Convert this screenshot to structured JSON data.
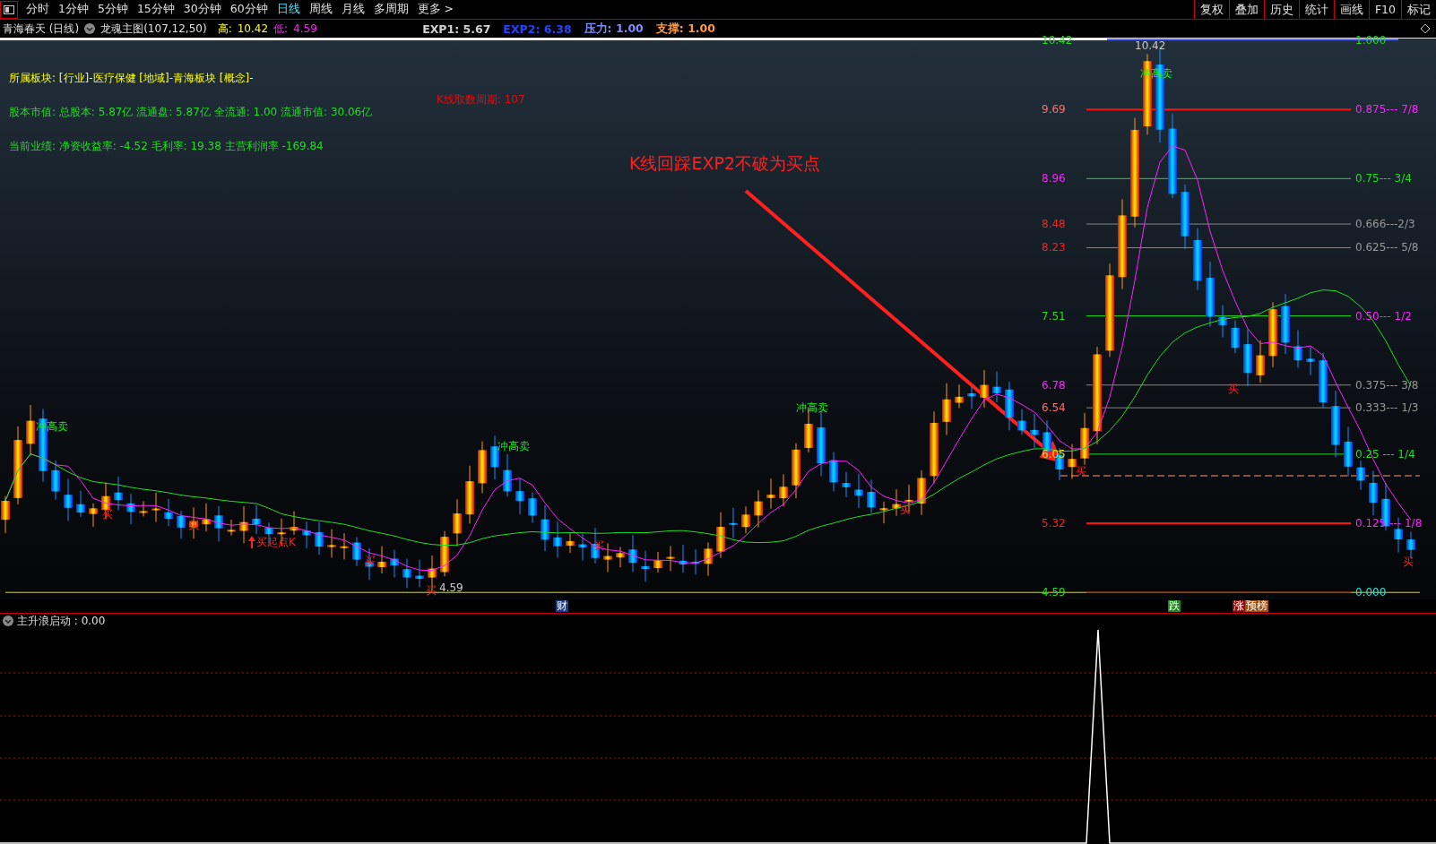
{
  "toolbar": {
    "periods": [
      {
        "label": "分时",
        "selected": false
      },
      {
        "label": "1分钟",
        "selected": false
      },
      {
        "label": "5分钟",
        "selected": false
      },
      {
        "label": "15分钟",
        "selected": false
      },
      {
        "label": "30分钟",
        "selected": false
      },
      {
        "label": "60分钟",
        "selected": false
      },
      {
        "label": "日线",
        "selected": true
      },
      {
        "label": "周线",
        "selected": false
      },
      {
        "label": "月线",
        "selected": false
      },
      {
        "label": "多周期",
        "selected": false
      },
      {
        "label": "更多 >",
        "selected": false
      }
    ],
    "tools": [
      "复权",
      "叠加",
      "历史",
      "统计",
      "画线",
      "F10",
      "标记"
    ]
  },
  "info_bar": {
    "stock": "青海春天 (日线)",
    "indicator": "龙魂主图(107,12,50)",
    "high_label": "高:",
    "high": "10.42",
    "low_label": "低:",
    "low": "4.59",
    "values": [
      {
        "text": "EXP1: 5.67",
        "kind": "exp1"
      },
      {
        "text": "EXP2: 6.38",
        "kind": "exp2"
      },
      {
        "text": "压力: 1.00",
        "kind": "pressure"
      },
      {
        "text": "支撑: 1.00",
        "kind": "support"
      }
    ]
  },
  "chart": {
    "info_lines": [
      {
        "text": "所属板块: [行业]-医疗保健 [地域]-青海板块 [概念]-",
        "color": "#ffff00"
      },
      {
        "text": "股本市值: 总股本: 5.87亿 流通盘: 5.87亿 全流通: 1.00 流通市值: 30.06亿",
        "color": "#22dd22"
      },
      {
        "text": "当前业绩: 净资收益率: -4.52 毛利率: 19.38 主营利润率 -169.84",
        "color": "#22dd22"
      }
    ],
    "period_note": "K线取数周期: 107",
    "annotation": "K线回踩EXP2不破为买点",
    "levels": [
      {
        "price": "10.42",
        "ratio": "1.000",
        "kind": "top"
      },
      {
        "price": "9.69",
        "ratio": "0.875--- 7/8",
        "kind": "resist"
      },
      {
        "price": "8.96",
        "ratio": "0.75--- 3/4",
        "kind": "fib"
      },
      {
        "price": "8.48",
        "ratio": "0.666---2/3",
        "kind": "minor"
      },
      {
        "price": "8.23",
        "ratio": "0.625--- 5/8",
        "kind": "minor"
      },
      {
        "price": "7.51",
        "ratio": "0.50--- 1/2",
        "kind": "fib"
      },
      {
        "price": "6.78",
        "ratio": "0.375--- 3/8",
        "kind": "minor"
      },
      {
        "price": "6.54",
        "ratio": "0.333--- 1/3",
        "kind": "minor"
      },
      {
        "price": "6.05",
        "ratio": "0.25 --- 1/4",
        "kind": "fib"
      },
      {
        "price": "5.32",
        "ratio": "0.125 --- 1/8",
        "kind": "resist"
      },
      {
        "price": "4.59",
        "ratio": "0.000",
        "kind": "bottom"
      }
    ],
    "signals": [
      {
        "text": "冲高卖",
        "kind": "sell"
      },
      {
        "text": "冲高卖",
        "kind": "sell"
      },
      {
        "text": "冲高卖",
        "kind": "sell"
      },
      {
        "text": "冲高卖",
        "kind": "sell"
      },
      {
        "text": "买",
        "kind": "buy"
      },
      {
        "text": "买",
        "kind": "buy"
      },
      {
        "text": "买",
        "kind": "buy"
      },
      {
        "text": "买",
        "kind": "buy"
      },
      {
        "text": "买",
        "kind": "buy"
      },
      {
        "text": "买",
        "kind": "buy"
      },
      {
        "text": "买",
        "kind": "buy"
      },
      {
        "text": "买",
        "kind": "buy"
      },
      {
        "text": "买",
        "kind": "buy"
      },
      {
        "text": "买起点K",
        "kind": "start"
      },
      {
        "text": "4.59",
        "kind": "price"
      },
      {
        "text": "10.42",
        "kind": "price"
      }
    ],
    "tags": [
      {
        "text": "财",
        "color": "#1a3a8a"
      },
      {
        "text": "跌",
        "color": "#1a8a1a"
      },
      {
        "text": "涨",
        "color": "#8a1010"
      },
      {
        "text": "预榜",
        "color": "#a05010"
      }
    ]
  },
  "sub_pane": {
    "title": "主升浪启动 : 0.00"
  }
}
